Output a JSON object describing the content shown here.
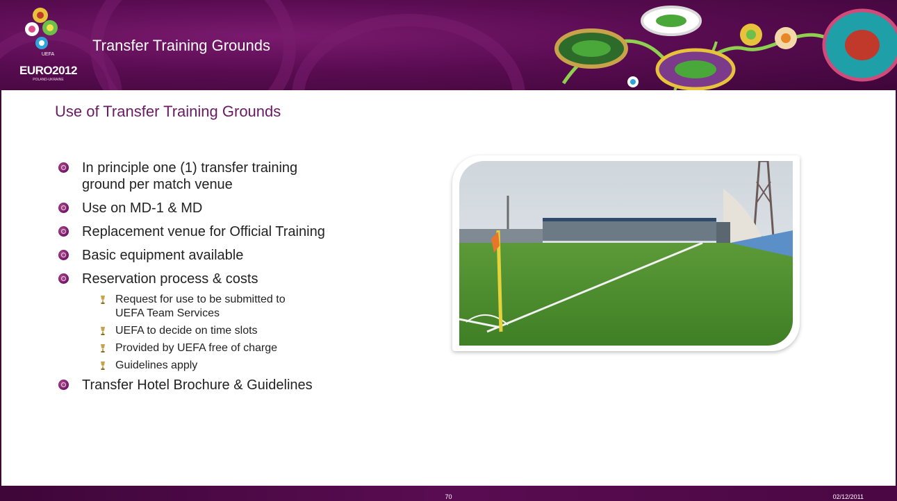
{
  "header": {
    "title": "Transfer Training Grounds",
    "logo_text": "EURO2012",
    "logo_sub": "POLAND-UKRAINE"
  },
  "subtitle": "Use of Transfer Training Grounds",
  "bullets": [
    "In principle one (1) transfer training ground per match venue",
    "Use on MD-1 & MD",
    "Replacement venue for Official Training",
    "Basic equipment available",
    "Reservation process & costs"
  ],
  "sub_bullets": [
    "Request for use to be submitted to UEFA Team Services",
    "UEFA to decide on time slots",
    "Provided by UEFA free of charge",
    "Guidelines apply"
  ],
  "last_bullet": "Transfer Hotel Brochure & Guidelines",
  "footer": {
    "page_number": "70",
    "date": "02/12/2011"
  },
  "colors": {
    "brand_purple": "#5a0c52",
    "subtitle_purple": "#6a1a63",
    "pitch_green": "#3f8a2a"
  }
}
